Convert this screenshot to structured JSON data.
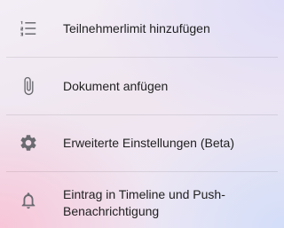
{
  "menu": {
    "items": [
      {
        "label": "Teilnehmerlimit hinzufügen",
        "icon": "numbered-list-icon"
      },
      {
        "label": "Dokument anfügen",
        "icon": "paperclip-icon"
      },
      {
        "label": "Erweiterte Einstellungen (Beta)",
        "icon": "gear-icon"
      },
      {
        "label": "Eintrag in Timeline und Push-Benachrichtigung",
        "icon": "bell-icon"
      }
    ]
  },
  "colors": {
    "text": "#1f1f1f",
    "icon": "#6a6a70",
    "divider": "rgba(0,0,0,0.09)"
  }
}
